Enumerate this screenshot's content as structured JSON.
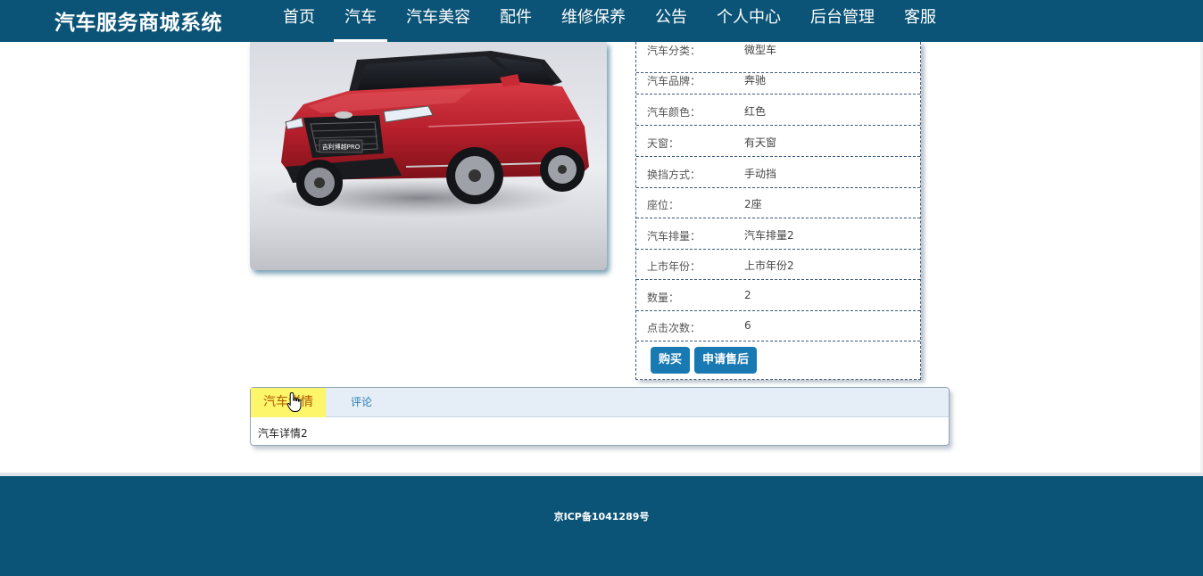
{
  "header": {
    "brand": "汽车服务商城系统",
    "nav": [
      {
        "label": "首页",
        "active": false
      },
      {
        "label": "汽车",
        "active": true
      },
      {
        "label": "汽车美容",
        "active": false
      },
      {
        "label": "配件",
        "active": false
      },
      {
        "label": "维修保养",
        "active": false
      },
      {
        "label": "公告",
        "active": false
      },
      {
        "label": "个人中心",
        "active": false
      },
      {
        "label": "后台管理",
        "active": false
      },
      {
        "label": "客服",
        "active": false
      }
    ]
  },
  "car": {
    "plate_text": "吉利博越PRO"
  },
  "specs": [
    {
      "label": "汽车分类：",
      "value": "微型车"
    },
    {
      "label": "汽车品牌：",
      "value": "奔驰"
    },
    {
      "label": "汽车颜色：",
      "value": "红色"
    },
    {
      "label": "天窗：",
      "value": "有天窗"
    },
    {
      "label": "换挡方式：",
      "value": "手动挡"
    },
    {
      "label": "座位：",
      "value": "2座"
    },
    {
      "label": "汽车排量：",
      "value": "汽车排量2"
    },
    {
      "label": "上市年份：",
      "value": "上市年份2"
    },
    {
      "label": "数量：",
      "value": "2"
    },
    {
      "label": "点击次数：",
      "value": "6"
    }
  ],
  "actions": {
    "buy_label": "购买",
    "after_sales_label": "申请售后"
  },
  "tabs": [
    {
      "label": "汽车详情",
      "active": true
    },
    {
      "label": "评论",
      "active": false
    }
  ],
  "tab_content": "汽车详情2",
  "footer": {
    "icp": "京ICP备1041289号"
  },
  "colors": {
    "header_bg": "#0b5477",
    "button_bg": "#1879b3",
    "active_tab_bg": "#fdf56a",
    "active_tab_text": "#b25a00"
  }
}
